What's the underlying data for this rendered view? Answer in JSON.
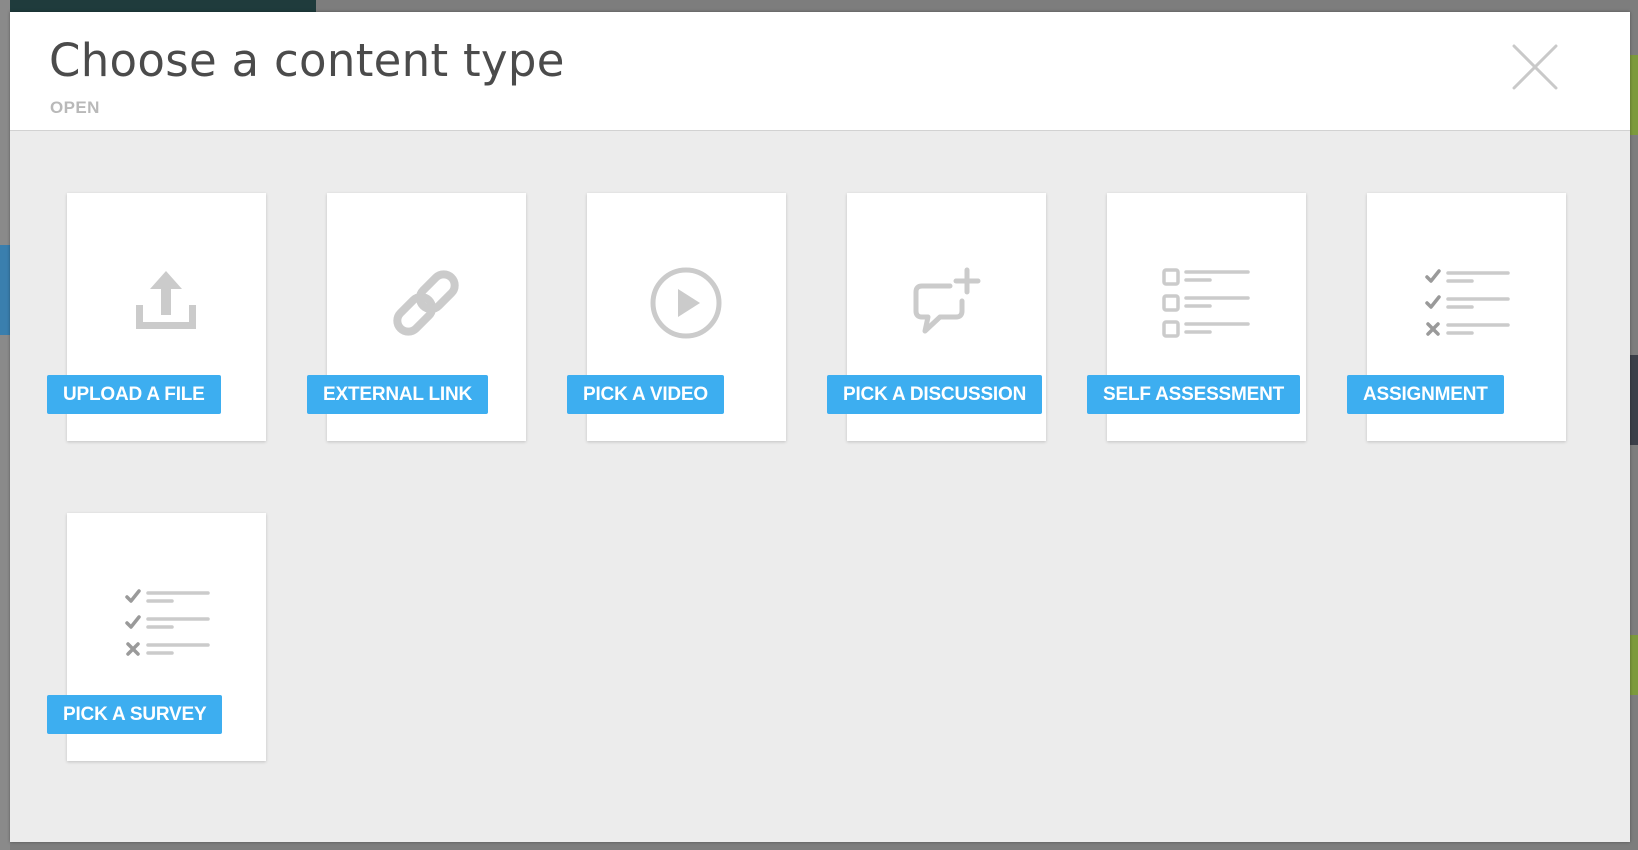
{
  "modal": {
    "title": "Choose a content type",
    "subtitle": "OPEN",
    "close_icon": "close-icon"
  },
  "content_types": [
    {
      "label": "UPLOAD A FILE",
      "icon": "upload-icon"
    },
    {
      "label": "EXTERNAL LINK",
      "icon": "link-icon"
    },
    {
      "label": "PICK A VIDEO",
      "icon": "play-icon"
    },
    {
      "label": "PICK A DISCUSSION",
      "icon": "discussion-add-icon"
    },
    {
      "label": "SELF ASSESSMENT",
      "icon": "checklist-icon"
    },
    {
      "label": "ASSIGNMENT",
      "icon": "task-list-icon"
    },
    {
      "label": "PICK A SURVEY",
      "icon": "survey-list-icon"
    }
  ],
  "colors": {
    "label_bg": "#3daef0",
    "icon_gray": "#cbcbcb",
    "modal_body_bg": "#ececec"
  }
}
